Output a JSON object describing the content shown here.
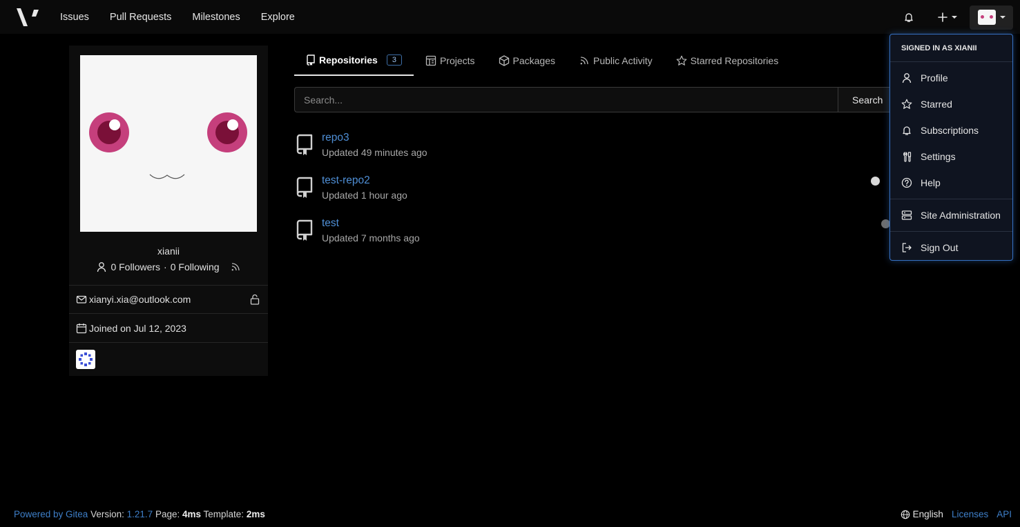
{
  "nav": {
    "links": [
      "Issues",
      "Pull Requests",
      "Milestones",
      "Explore"
    ],
    "icons": [
      "bell-icon",
      "plus-icon",
      "avatar"
    ]
  },
  "profile": {
    "name": "xianii",
    "followers": "0 Followers",
    "separator": "·",
    "following": "0 Following",
    "email": "xianyi.xia@outlook.com",
    "joined": "Joined on Jul 12, 2023",
    "avatar_colors": {
      "background": "#f6f6f6",
      "eye": "#c53f7c",
      "pupil": "#7a1038"
    }
  },
  "tabs": [
    {
      "label": "Repositories",
      "count": "3",
      "icon": "repo-icon",
      "active": true
    },
    {
      "label": "Projects",
      "icon": "project-icon"
    },
    {
      "label": "Packages",
      "icon": "package-icon"
    },
    {
      "label": "Public Activity",
      "icon": "rss-icon"
    },
    {
      "label": "Starred Repositories",
      "icon": "star-icon"
    }
  ],
  "search": {
    "placeholder": "Search...",
    "button": "Search"
  },
  "repos": [
    {
      "name": "repo3",
      "updated": "Updated 49 minutes ago"
    },
    {
      "name": "test-repo2",
      "updated": "Updated 1 hour ago"
    },
    {
      "name": "test",
      "updated": "Updated 7 months ago"
    }
  ],
  "dropdown": {
    "header": "SIGNED IN AS XIANII",
    "items": [
      "Profile",
      "Starred",
      "Subscriptions",
      "Settings",
      "Help"
    ],
    "admin": "Site Administration",
    "signout": "Sign Out"
  },
  "footer": {
    "powered": "Powered by Gitea",
    "version_label": "Version:",
    "version": "1.21.7",
    "page_label": "Page:",
    "page_time": "4ms",
    "template_label": "Template:",
    "template_time": "2ms",
    "language": "English",
    "licenses": "Licenses",
    "api": "API"
  },
  "colors": {
    "accent": "#3571c4",
    "link": "#4f8fd6",
    "background": "#000000"
  }
}
